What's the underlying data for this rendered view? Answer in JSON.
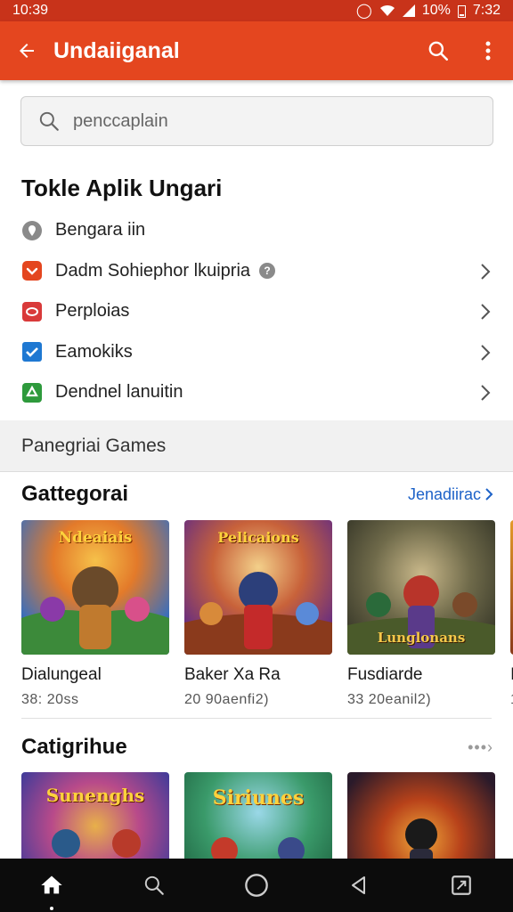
{
  "status_bar": {
    "time_left": "10:39",
    "battery": "10%",
    "time_right": "7:32"
  },
  "app_bar": {
    "title": "Undaiiganal"
  },
  "search": {
    "placeholder": "penccaplain"
  },
  "settings": {
    "title": "Tokle Aplik Ungari",
    "items": [
      {
        "label": "Bengara iin",
        "icon": "location-pin-icon",
        "color": "#7a7a7a",
        "chevron": false,
        "badge": ""
      },
      {
        "label": "Dadm Sohiephor lkuipria",
        "icon": "shield-icon",
        "color": "#e4461f",
        "chevron": true,
        "badge": "?"
      },
      {
        "label": "Perploias",
        "icon": "message-icon",
        "color": "#d93a3a",
        "chevron": true,
        "badge": ""
      },
      {
        "label": "Eamokiks",
        "icon": "checkbox-icon",
        "color": "#1e78d2",
        "chevron": true,
        "badge": ""
      },
      {
        "label": "Dendnel lanuitin",
        "icon": "recycle-icon",
        "color": "#2e9a3c",
        "chevron": true,
        "badge": ""
      }
    ]
  },
  "band": {
    "label": "Panegriai Games"
  },
  "row1": {
    "title": "Gattegorai",
    "more": "Jenadiirac",
    "cards": [
      {
        "name": "Dialungeal",
        "meta": "38: 20ss",
        "art": "Ndeaiais"
      },
      {
        "name": "Baker Xa Ra",
        "meta": "20 90aenfi2)",
        "art": "Pelicaions"
      },
      {
        "name": "Fusdiarde",
        "meta": "33 20eanil2)",
        "art": "Lunglonans"
      },
      {
        "name": "I",
        "meta": "1",
        "art": ""
      }
    ]
  },
  "row2": {
    "title": "Catigrihue",
    "more_dots": "•••›",
    "cards": [
      {
        "art": "Sunenghs"
      },
      {
        "art": "Siriunes"
      },
      {
        "art": ""
      }
    ]
  },
  "colors": {
    "accent": "#e4461f",
    "status_bar": "#c8331a",
    "link": "#1d62c8"
  }
}
